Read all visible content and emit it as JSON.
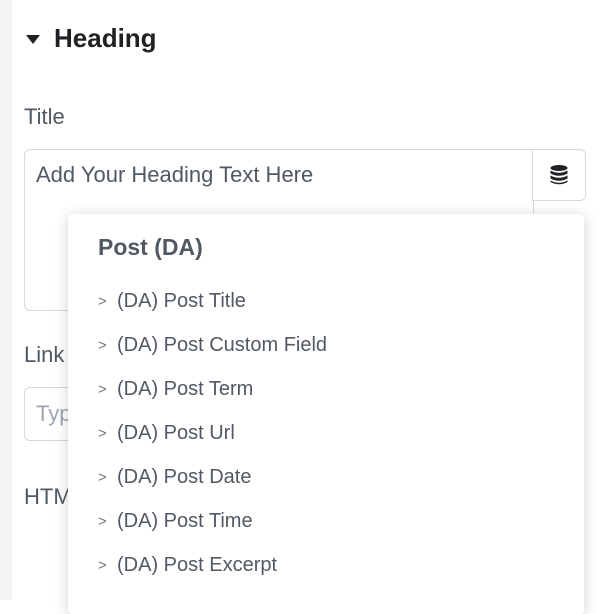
{
  "section": {
    "title": "Heading"
  },
  "title_control": {
    "label": "Title",
    "value": "Add Your Heading Text Here"
  },
  "link_control": {
    "label": "Link",
    "placeholder": "Type"
  },
  "html_control": {
    "label": "HTML"
  },
  "dynamic_tags_icon": "database-icon",
  "dropdown": {
    "group_title": "Post (DA)",
    "item_marker": ">",
    "items": [
      {
        "label": "(DA) Post Title"
      },
      {
        "label": "(DA) Post Custom Field"
      },
      {
        "label": "(DA) Post Term"
      },
      {
        "label": "(DA) Post Url"
      },
      {
        "label": "(DA) Post Date"
      },
      {
        "label": "(DA) Post Time"
      },
      {
        "label": "(DA) Post Excerpt"
      }
    ]
  }
}
